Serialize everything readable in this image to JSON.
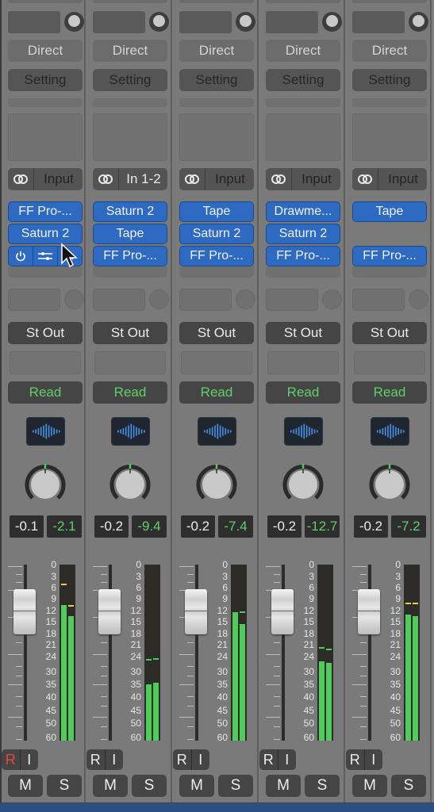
{
  "colors": {
    "slot_blue": "#2e6ac2",
    "read_green": "#5fd06a",
    "meter_green": "#4fcc5a",
    "peak_hold_yellow": "#e6d040",
    "peak_hold_green": "#4fcc5a",
    "record_red": "#e04a3a"
  },
  "meter_scale": [
    "0",
    "3",
    "6",
    "9",
    "12",
    "15",
    "18",
    "21",
    "24",
    "30",
    "35",
    "40",
    "45",
    "50",
    "60"
  ],
  "channels": [
    {
      "direct_label": "Direct",
      "setting_label": "Setting",
      "input_label": "Input",
      "input_active": false,
      "plugins": [
        "FF Pro-...",
        "Saturn 2",
        null
      ],
      "plugin_controls": [
        "power-icon",
        "sliders-icon",
        "more-icon"
      ],
      "output_label": "St Out",
      "automation_label": "Read",
      "volume": "-0.1",
      "peak": "-2.1",
      "meter_levels_db": [
        10.5,
        13.5
      ],
      "meter_peak_holds_db": [
        5,
        10.5
      ],
      "peak_hold_color": "yellow",
      "record_label": "R",
      "input_monitor_label": "I",
      "record_armed": true,
      "mute_label": "M",
      "solo_label": "S"
    },
    {
      "direct_label": "Direct",
      "setting_label": "Setting",
      "input_label": "In 1-2",
      "input_active": true,
      "plugins": [
        "Saturn 2",
        "Tape",
        "FF Pro-..."
      ],
      "output_label": "St Out",
      "automation_label": "Read",
      "volume": "-0.2",
      "peak": "-9.4",
      "meter_levels_db": [
        35,
        34.5
      ],
      "meter_peak_holds_db": [
        25,
        24.5
      ],
      "peak_hold_color": "green",
      "record_label": "R",
      "input_monitor_label": "I",
      "record_armed": false,
      "mute_label": "M",
      "solo_label": "S"
    },
    {
      "direct_label": "Direct",
      "setting_label": "Setting",
      "input_label": "Input",
      "input_active": false,
      "plugins": [
        "Tape",
        "Saturn 2",
        "FF Pro-..."
      ],
      "output_label": "St Out",
      "automation_label": "Read",
      "volume": "-0.2",
      "peak": "-7.4",
      "meter_levels_db": [
        12.5,
        15.5
      ],
      "meter_peak_holds_db": [
        12.5,
        12.3
      ],
      "peak_hold_color": "green",
      "record_label": "R",
      "input_monitor_label": "I",
      "record_armed": false,
      "mute_label": "M",
      "solo_label": "S"
    },
    {
      "direct_label": "Direct",
      "setting_label": "Setting",
      "input_label": "Input",
      "input_active": false,
      "plugins": [
        "Drawme...",
        "Saturn 2",
        "FF Pro-..."
      ],
      "output_label": "St Out",
      "automation_label": "Read",
      "volume": "-0.2",
      "peak": "-12.7",
      "meter_levels_db": [
        26,
        26.5
      ],
      "meter_peak_holds_db": [
        21.5,
        22
      ],
      "peak_hold_color": "green",
      "record_label": "R",
      "input_monitor_label": "I",
      "record_armed": false,
      "mute_label": "M",
      "solo_label": "S"
    },
    {
      "direct_label": "Direct",
      "setting_label": "Setting",
      "input_label": "Input",
      "input_active": false,
      "plugins": [
        "Tape",
        null,
        "FF Pro-..."
      ],
      "output_label": "St Out",
      "automation_label": "Read",
      "volume": "-0.2",
      "peak": "-7.2",
      "meter_levels_db": [
        13,
        13.5
      ],
      "meter_peak_holds_db": [
        10,
        10
      ],
      "peak_hold_color": "yellow",
      "record_label": "R",
      "input_monitor_label": "I",
      "record_armed": false,
      "mute_label": "M",
      "solo_label": "S"
    }
  ]
}
